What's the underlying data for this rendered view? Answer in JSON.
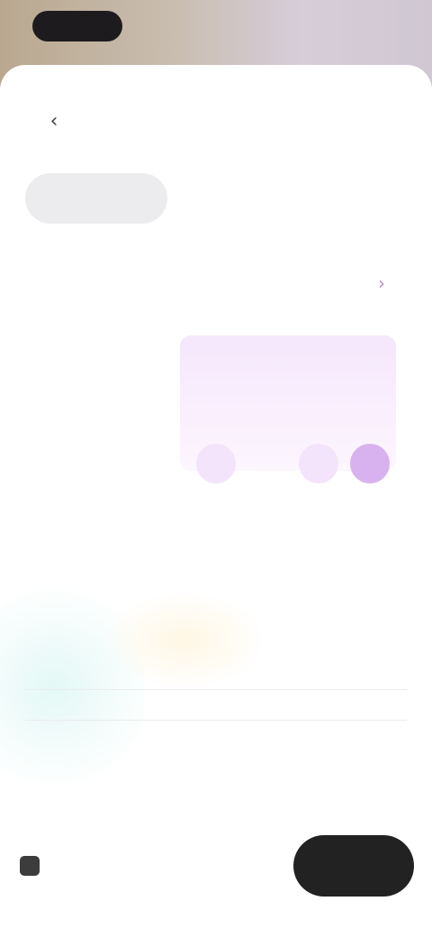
{
  "header": {
    "title": "",
    "back_icon": "chevron-left-icon"
  },
  "segments": [
    {
      "label": "",
      "active": true
    },
    {
      "label": "",
      "active": false
    },
    {
      "label": "",
      "active": false
    }
  ],
  "calendar": {
    "month_label": "",
    "next_icon": "chevron-right-icon",
    "weekdays": [
      "",
      "",
      "",
      "",
      "",
      "",
      ""
    ],
    "days": [
      "",
      "",
      "",
      "",
      "",
      "",
      "",
      "",
      "",
      "",
      "",
      "",
      "",
      "",
      "",
      "",
      "",
      ""
    ]
  },
  "time_picker": {
    "items": [
      "",
      "",
      "",
      "",
      ""
    ]
  },
  "footer": {
    "summary_icon": "calendar-icon",
    "summary_text": "",
    "confirm_label": ""
  },
  "colors": {
    "accent": "#d8b2ef",
    "range": "#f3e4fb",
    "button": "#222222"
  }
}
